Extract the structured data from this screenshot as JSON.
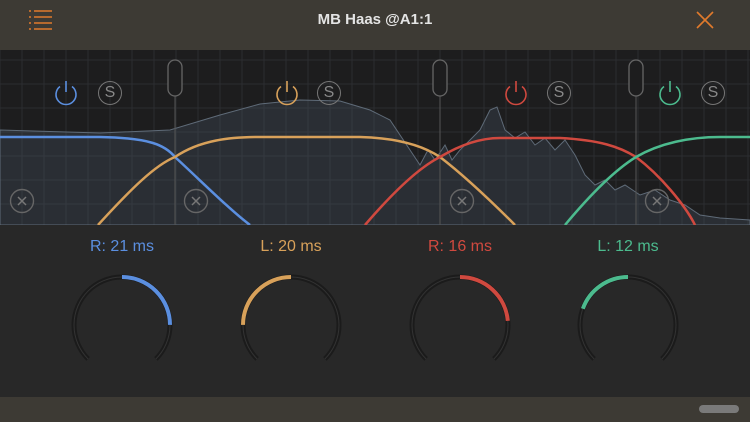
{
  "header": {
    "title": "MB Haas @A1:1",
    "menu_icon": "list-icon",
    "close_icon": "close-icon",
    "accent": "#e07a2c"
  },
  "bands": [
    {
      "name": "band-1",
      "color": "#5b8fe0",
      "delay_label": "R: 21 ms",
      "side": "R",
      "delay_ms": 21,
      "fill_fraction": 0.333
    },
    {
      "name": "band-2",
      "color": "#d8a15a",
      "delay_label": "L: 20 ms",
      "side": "L",
      "delay_ms": 20,
      "fill_fraction": 0.333
    },
    {
      "name": "band-3",
      "color": "#d0493f",
      "delay_label": "R: 16 ms",
      "side": "R",
      "delay_ms": 16,
      "fill_fraction": 0.315
    },
    {
      "name": "band-4",
      "color": "#4cbb8e",
      "delay_label": "L: 12 ms",
      "side": "L",
      "delay_ms": 12,
      "fill_fraction": 0.26
    }
  ],
  "solo_label": "S"
}
